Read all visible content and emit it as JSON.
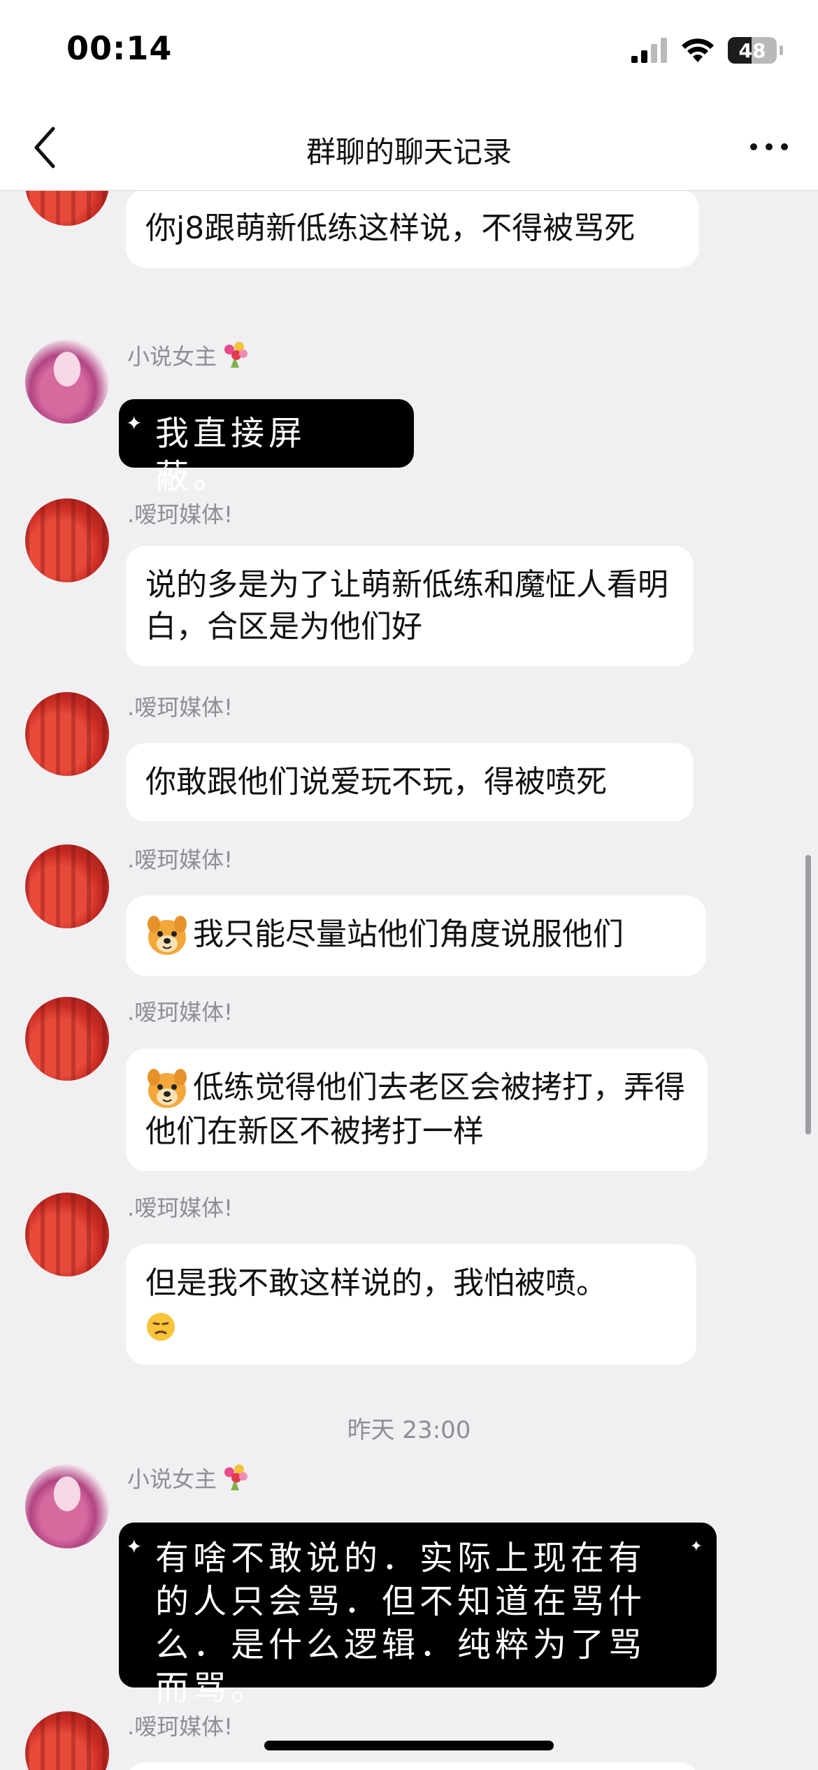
{
  "status_bar": {
    "time": "00:14",
    "battery": "48"
  },
  "nav": {
    "title": "群聊的聊天记录"
  },
  "messages": [
    {
      "sender": "",
      "text": "你j8跟萌新低练这样说，不得被骂死"
    },
    {
      "sender": "小说女主",
      "text": "我直接屏蔽。"
    },
    {
      "sender": ".嗳珂媒体!",
      "text": "说的多是为了让萌新低练和魔怔人看明白，合区是为他们好"
    },
    {
      "sender": ".嗳珂媒体!",
      "text": "你敢跟他们说爱玩不玩，得被喷死"
    },
    {
      "sender": ".嗳珂媒体!",
      "text": "我只能尽量站他们角度说服他们"
    },
    {
      "sender": ".嗳珂媒体!",
      "text": "低练觉得他们去老区会被拷打，弄得他们在新区不被拷打一样"
    },
    {
      "sender": ".嗳珂媒体!",
      "text": "但是我不敢这样说的，我怕被喷。"
    },
    {
      "sender": "小说女主",
      "text": "有啥不敢说的．实际上现在有的人只会骂．但不知道在骂什么．是什么逻辑．纯粹为了骂而骂。"
    },
    {
      "sender": ".嗳珂媒体!",
      "text": ""
    }
  ],
  "timestamp": "昨天 23:00",
  "icons": {
    "back": "chevron-left-icon",
    "more": "more-dots-icon",
    "flower": "bouquet-emoji",
    "dog": "dog-face-emoji",
    "sad": "unamused-face-emoji"
  },
  "colors": {
    "background": "#f0f0f3",
    "bubble": "#ffffff",
    "black_bubble": "#000000",
    "meta_text": "#8e8e93"
  }
}
